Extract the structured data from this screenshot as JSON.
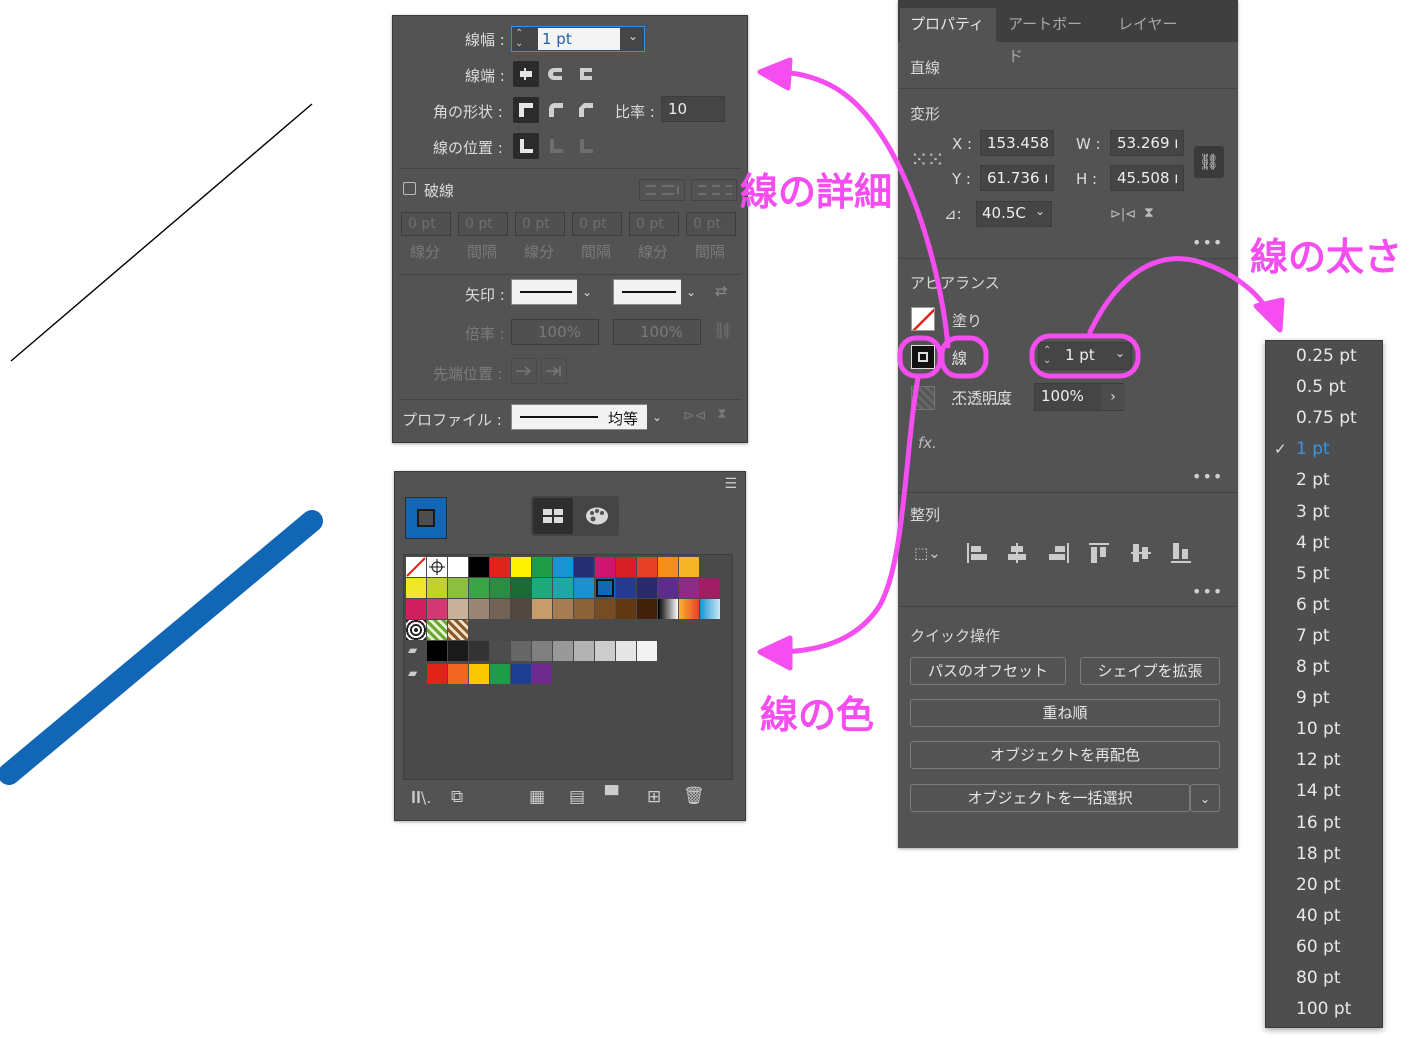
{
  "stroke_panel": {
    "weight_label": "線幅 :",
    "weight_value": "1 pt",
    "cap_label": "線端 :",
    "corner_label": "角の形状 :",
    "ratio_label": "比率 :",
    "ratio_value": "10",
    "align_label": "線の位置 :",
    "dashed_label": "破線",
    "dash_fields": [
      "0 pt",
      "0 pt",
      "0 pt",
      "0 pt",
      "0 pt",
      "0 pt"
    ],
    "dash_labels": [
      "線分",
      "間隔",
      "線分",
      "間隔",
      "線分",
      "間隔"
    ],
    "arrow_label": "矢印 :",
    "scale_label": "倍率 :",
    "scale_value_1": "100%",
    "scale_value_2": "100%",
    "tip_label": "先端位置 :",
    "profile_label": "プロファイル :",
    "profile_value": "均等"
  },
  "props_panel": {
    "tabs": [
      "プロパティ",
      "アートボード",
      "レイヤー"
    ],
    "object_type": "直線",
    "transform_title": "変形",
    "x_label": "X :",
    "x_value": "153.458",
    "y_label": "Y :",
    "y_value": "61.736 ı",
    "w_label": "W :",
    "w_value": "53.269 ı",
    "h_label": "H :",
    "h_value": "45.508 ı",
    "angle_label": "⊿:",
    "angle_value": "40.5C",
    "appearance_title": "アピアランス",
    "fill_label": "塗り",
    "stroke_label": "線",
    "stroke_weight": "1 pt",
    "opacity_label": "不透明度",
    "opacity_value": "100%",
    "fx_label": "fx.",
    "align_title": "整列",
    "quick_title": "クイック操作",
    "btn_offset": "パスのオフセット",
    "btn_expand": "シェイプを拡張",
    "btn_arrange": "重ね順",
    "btn_recolor": "オブジェクトを再配色",
    "btn_select_same": "オブジェクトを一括選択"
  },
  "size_menu": {
    "items": [
      "0.25 pt",
      "0.5 pt",
      "0.75 pt",
      "1 pt",
      "2 pt",
      "3 pt",
      "4 pt",
      "5 pt",
      "6 pt",
      "7 pt",
      "8 pt",
      "9 pt",
      "10 pt",
      "12 pt",
      "14 pt",
      "16 pt",
      "18 pt",
      "20 pt",
      "40 pt",
      "60 pt",
      "80 pt",
      "100 pt"
    ],
    "selected": "1 pt"
  },
  "annotations": {
    "detail": "線の詳細",
    "weight": "線の太さ",
    "color": "線の色"
  },
  "colors": {
    "panel_bg": "#535353",
    "accent_pink": "#f54df0",
    "stroke_blue": "#1167b6",
    "menu_selected": "#3a95e4"
  },
  "swatches": {
    "row1": [
      "#ffffff",
      "#000000",
      "#e2231a",
      "#fff200",
      "#1f9c48",
      "#1a93d1",
      "#272e74",
      "#d3146f",
      "#d81f26",
      "#e83f27",
      "#f18e1c",
      "#f7b52a"
    ],
    "row2": [
      "#efe72c",
      "#c3d22a",
      "#8cbf3f",
      "#3aa447",
      "#2a8d41",
      "#1c6b37",
      "#1faa7b",
      "#20a6a9",
      "#1a90d0",
      "#1167b6",
      "#253b8f",
      "#2a2a6d",
      "#5c2d8a",
      "#8e2a88",
      "#a01e63"
    ],
    "row3": [
      "#cf1f5d",
      "#d23872",
      "#c7b299",
      "#998675",
      "#736357",
      "#534741",
      "#c69c6d",
      "#a67c52",
      "#8c6239",
      "#754c24",
      "#603813",
      "#42210b"
    ],
    "grays": [
      "#000000",
      "#1a1a1a",
      "#333333",
      "#4d4d4d",
      "#666666",
      "#808080",
      "#999999",
      "#b3b3b3",
      "#cccccc",
      "#e6e6e6",
      "#f2f2f2"
    ],
    "group": [
      "#e2231a",
      "#f26522",
      "#fbc800",
      "#1f9c48",
      "#1c3f94",
      "#6d2a8a"
    ]
  }
}
